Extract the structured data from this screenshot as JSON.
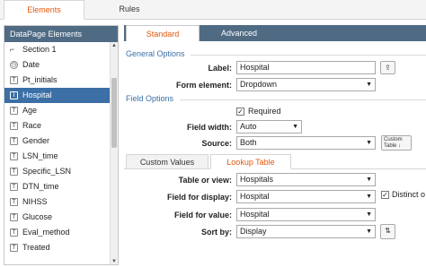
{
  "top_tabs": [
    {
      "label": "Elements",
      "active": true
    },
    {
      "label": "Rules",
      "active": false
    }
  ],
  "left_panel": {
    "header": "DataPage Elements",
    "items": [
      {
        "label": "Section 1",
        "icon": "section-icon",
        "selected": false
      },
      {
        "label": "Date",
        "icon": "clock-icon",
        "selected": false
      },
      {
        "label": "Pt_initials",
        "icon": "text-field-icon",
        "selected": false
      },
      {
        "label": "Hospital",
        "icon": "info-field-icon",
        "selected": true
      },
      {
        "label": "Age",
        "icon": "text-field-icon",
        "selected": false
      },
      {
        "label": "Race",
        "icon": "text-field-icon",
        "selected": false
      },
      {
        "label": "Gender",
        "icon": "text-field-icon",
        "selected": false
      },
      {
        "label": "LSN_time",
        "icon": "text-field-icon",
        "selected": false
      },
      {
        "label": "Specific_LSN",
        "icon": "text-field-icon",
        "selected": false
      },
      {
        "label": "DTN_time",
        "icon": "text-field-icon",
        "selected": false
      },
      {
        "label": "NIHSS",
        "icon": "text-field-icon",
        "selected": false
      },
      {
        "label": "Glucose",
        "icon": "text-field-icon",
        "selected": false
      },
      {
        "label": "Eval_method",
        "icon": "text-field-icon",
        "selected": false
      },
      {
        "label": "Treated",
        "icon": "text-field-icon",
        "selected": false
      }
    ],
    "icon_glyphs": {
      "text": "T",
      "info": "I",
      "clock": "◷",
      "section": "⌐"
    }
  },
  "right_tabs": [
    {
      "label": "Standard",
      "active": true
    },
    {
      "label": "Advanced",
      "active": false
    }
  ],
  "general_options": {
    "title": "General Options",
    "label_label": "Label:",
    "label_value": "Hospital",
    "form_element_label": "Form element:",
    "form_element_value": "Dropdown"
  },
  "field_options": {
    "title": "Field Options",
    "required_label": "Required",
    "required_checked": true,
    "field_width_label": "Field width:",
    "field_width_value": "Auto",
    "source_label": "Source:",
    "source_value": "Both",
    "custom_table_button": "Custom Table"
  },
  "sub_tabs": [
    {
      "label": "Custom Values",
      "active": false
    },
    {
      "label": "Lookup Table",
      "active": true
    }
  ],
  "lookup": {
    "table_label": "Table or view:",
    "table_value": "Hospitals",
    "display_label": "Field for display:",
    "display_value": "Hospital",
    "distinct_label": "Distinct o",
    "distinct_checked": true,
    "value_label": "Field for value:",
    "value_value": "Hospital",
    "sort_label": "Sort by:",
    "sort_value": "Display"
  },
  "colors": {
    "header_bg": "#4f6b84",
    "selected_bg": "#3b6fa6",
    "active_tab_text": "#e4570f",
    "section_title": "#3b6fa6"
  }
}
